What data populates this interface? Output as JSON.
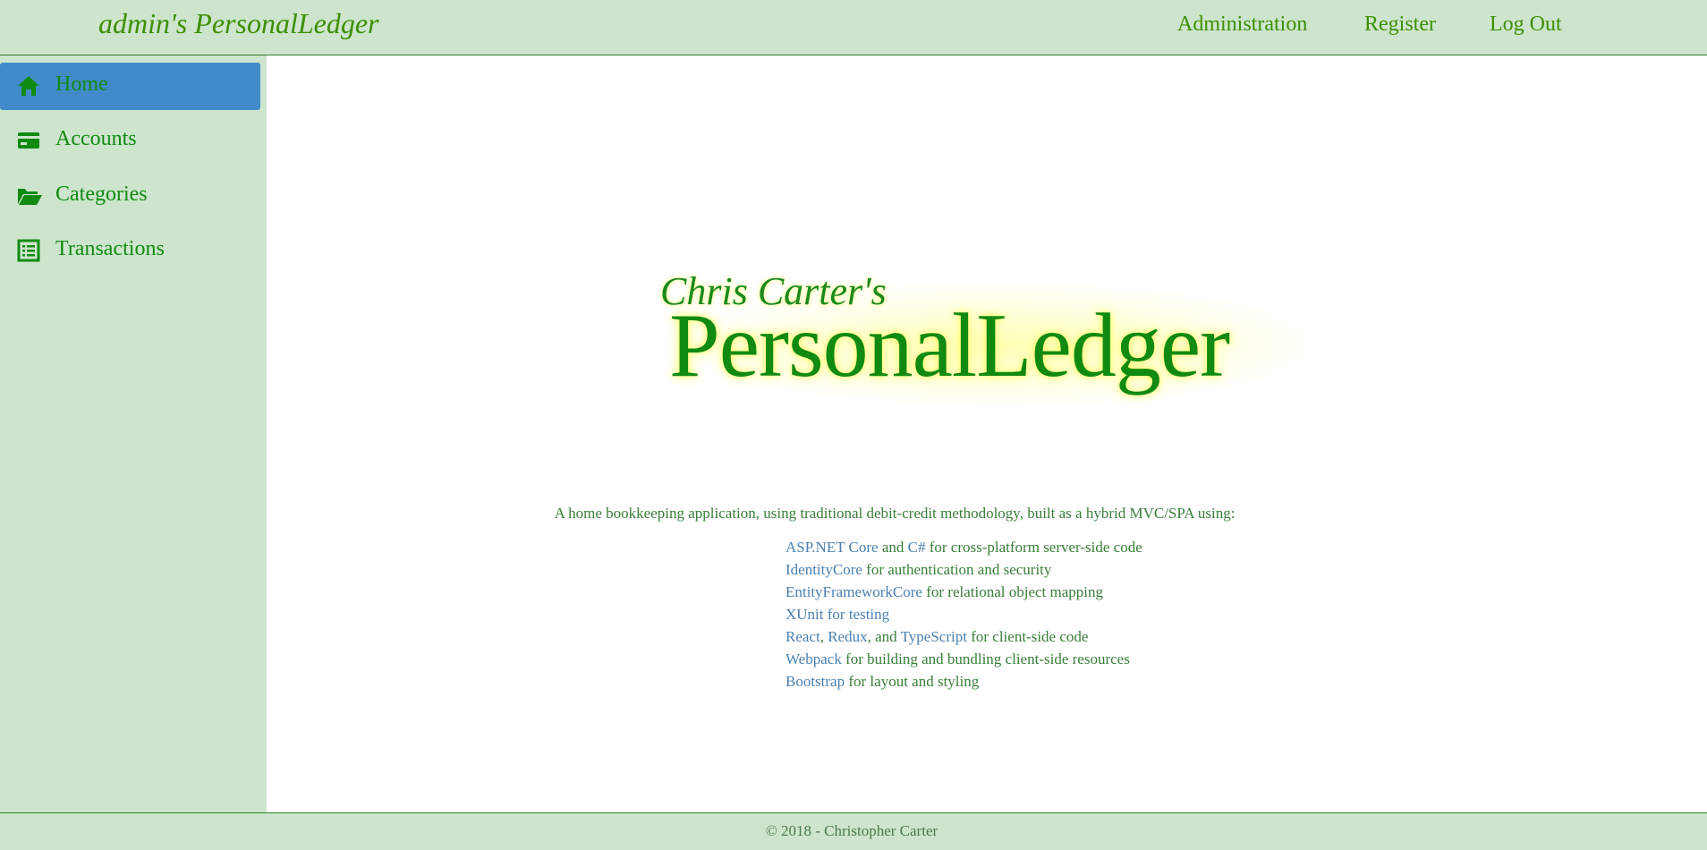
{
  "colors": {
    "nav_background": "#cde5cd",
    "accent_green": "#118a11",
    "link_blue": "#4a7fb0",
    "active_item": "#428bca"
  },
  "header": {
    "brand": "admin's PersonalLedger",
    "nav": [
      {
        "label": "Administration"
      },
      {
        "label": "Register"
      },
      {
        "label": "Log Out"
      }
    ]
  },
  "sidebar": {
    "items": [
      {
        "label": "Home",
        "icon": "home-icon",
        "active": true
      },
      {
        "label": "Accounts",
        "icon": "credit-card-icon",
        "active": false
      },
      {
        "label": "Categories",
        "icon": "folder-open-icon",
        "active": false
      },
      {
        "label": "Transactions",
        "icon": "list-icon",
        "active": false
      }
    ]
  },
  "main": {
    "logo": {
      "small": "Chris Carter's",
      "big": "PersonalLedger"
    },
    "intro": "A home bookkeeping application, using traditional debit-credit methodology, built as a hybrid MVC/SPA using:",
    "tech": [
      {
        "links": [
          "ASP.NET Core",
          "C#"
        ],
        "connectors": [
          " and ",
          " for cross-platform server-side code"
        ]
      },
      {
        "links": [
          "IdentityCore"
        ],
        "connectors": [
          " for authentication and security"
        ]
      },
      {
        "links": [
          "EntityFrameworkCore"
        ],
        "connectors": [
          " for relational object mapping"
        ]
      },
      {
        "links": [
          "XUnit for testing"
        ],
        "connectors": [
          ""
        ]
      },
      {
        "links": [
          "React",
          "Redux",
          "TypeScript"
        ],
        "connectors": [
          ", ",
          ", and ",
          " for client-side code"
        ]
      },
      {
        "links": [
          "Webpack"
        ],
        "connectors": [
          " for building and bundling client-side resources"
        ]
      },
      {
        "links": [
          "Bootstrap"
        ],
        "connectors": [
          " for layout and styling"
        ]
      }
    ]
  },
  "footer": {
    "text": "© 2018 - Christopher Carter"
  }
}
